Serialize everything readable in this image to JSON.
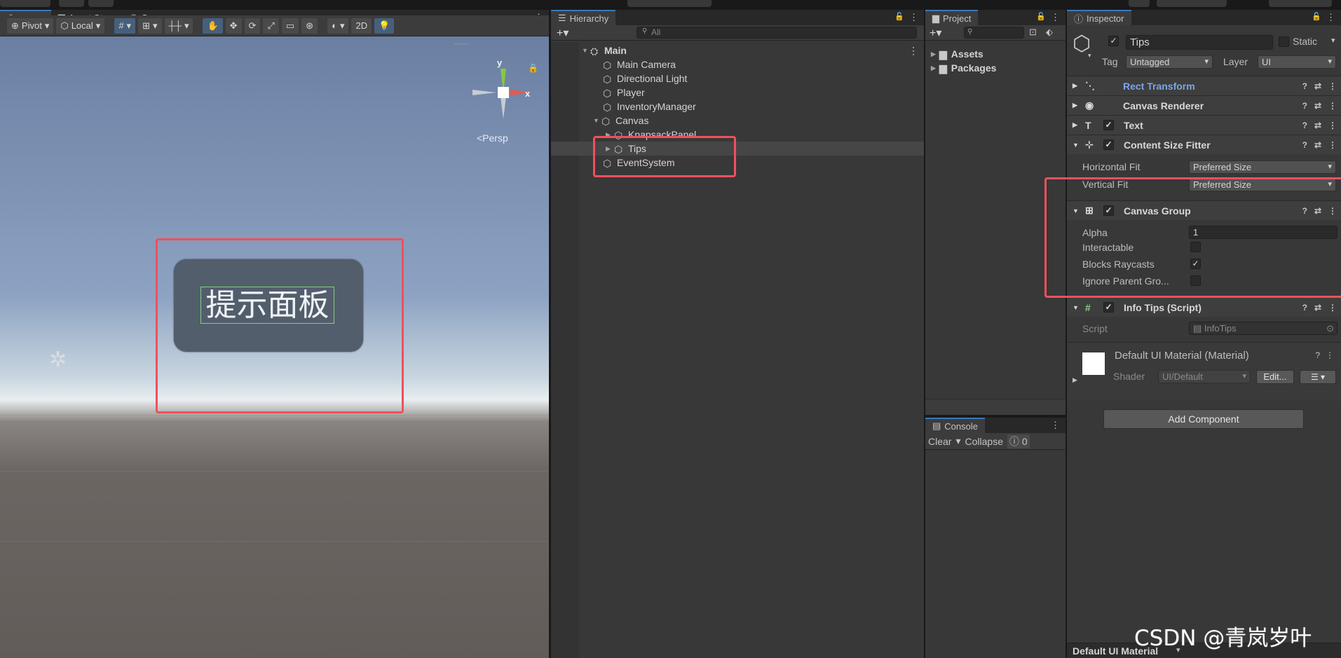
{
  "scene": {
    "tabs": [
      "Scene",
      "Asset Store",
      "Game"
    ],
    "toolbar": {
      "pivot": "Pivot",
      "local": "Local",
      "mode_2d": "2D"
    },
    "gizmo": {
      "y": "y",
      "x": "x",
      "persp": "<Persp"
    },
    "tip_text": "提示面板"
  },
  "hierarchy": {
    "tab": "Hierarchy",
    "search_placeholder": "All",
    "items": [
      {
        "label": "Main",
        "depth": 0,
        "expanded": true,
        "bold": true
      },
      {
        "label": "Main Camera",
        "depth": 1
      },
      {
        "label": "Directional Light",
        "depth": 1
      },
      {
        "label": "Player",
        "depth": 1
      },
      {
        "label": "InventoryManager",
        "depth": 1
      },
      {
        "label": "Canvas",
        "depth": 1,
        "expanded": true
      },
      {
        "label": "KnapsackPanel",
        "depth": 2
      },
      {
        "label": "Tips",
        "depth": 2,
        "collapsed": true,
        "selected": true
      },
      {
        "label": "EventSystem",
        "depth": 1
      }
    ]
  },
  "project": {
    "tab": "Project",
    "items": [
      "Assets",
      "Packages"
    ]
  },
  "console": {
    "tab": "Console",
    "clear": "Clear",
    "collapse": "Collapse",
    "error_count": "0"
  },
  "inspector": {
    "tab": "Inspector",
    "object_name": "Tips",
    "static_label": "Static",
    "tag_label": "Tag",
    "tag_value": "Untagged",
    "layer_label": "Layer",
    "layer_value": "UI",
    "components": {
      "rect_transform": "Rect Transform",
      "canvas_renderer": "Canvas Renderer",
      "text": "Text",
      "content_size_fitter": "Content Size Fitter",
      "canvas_group": "Canvas Group",
      "info_tips": "Info Tips (Script)"
    },
    "fitter": {
      "horizontal_label": "Horizontal Fit",
      "horizontal_value": "Preferred Size",
      "vertical_label": "Vertical Fit",
      "vertical_value": "Preferred Size"
    },
    "canvas_group": {
      "alpha_label": "Alpha",
      "alpha_value": "1",
      "interactable_label": "Interactable",
      "interactable": false,
      "blocks_label": "Blocks Raycasts",
      "blocks": true,
      "ignore_label": "Ignore Parent Gro...",
      "ignore": false
    },
    "script": {
      "label": "Script",
      "value": "InfoTips"
    },
    "material": {
      "name": "Default UI Material (Material)",
      "shader_label": "Shader",
      "shader_value": "UI/Default",
      "edit": "Edit..."
    },
    "add_component": "Add Component",
    "footer": "Default UI Material"
  },
  "watermark": "CSDN @青岚岁叶",
  "colors": {
    "highlight_red": "#f0505c",
    "accent_blue": "#3a79bb",
    "rect_transform_blue": "#7ba7e6"
  }
}
